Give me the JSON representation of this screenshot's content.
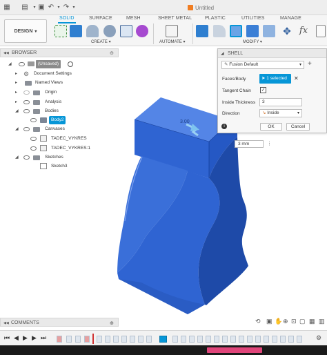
{
  "window": {
    "title": "Untitled"
  },
  "ribbon": {
    "tabs": [
      "SOLID",
      "SURFACE",
      "MESH",
      "SHEET METAL",
      "PLASTIC",
      "UTILITIES",
      "MANAGE"
    ],
    "workspace": "DESIGN",
    "groups": {
      "create": "CREATE",
      "automate": "AUTOMATE",
      "modify": "MODIFY"
    }
  },
  "browser": {
    "header": "BROWSER",
    "items": [
      {
        "label": "(Unsaved)"
      },
      {
        "label": "Document Settings"
      },
      {
        "label": "Named Views"
      },
      {
        "label": "Origin"
      },
      {
        "label": "Analysis"
      },
      {
        "label": "Bodies"
      },
      {
        "label": "Body2"
      },
      {
        "label": "Canvases"
      },
      {
        "label": "TADEC_VYKRES"
      },
      {
        "label": "TADEC_VYKRES:1"
      },
      {
        "label": "Sketches"
      },
      {
        "label": "Sketch3"
      }
    ]
  },
  "shell": {
    "title": "SHELL",
    "preset": "Fusion Default",
    "faces_label": "Faces/Body",
    "faces_value": "1 selected",
    "tangent_label": "Tangent Chain",
    "tangent_checked": true,
    "thickness_label": "Inside Thickness",
    "thickness_value": "3",
    "direction_label": "Direction",
    "direction_value": "Inside",
    "ok_label": "OK",
    "cancel_label": "Cancel"
  },
  "viewport": {
    "dimension_label": "3.00",
    "dimension_input": "3 mm",
    "model_color": "#2f64d2"
  },
  "comments": {
    "header": "COMMENTS"
  },
  "colors": {
    "accent": "#0696d7",
    "model_blue": "#2f64d2",
    "model_blue_dark": "#1e4aa8",
    "model_blue_light": "#5485e6"
  }
}
